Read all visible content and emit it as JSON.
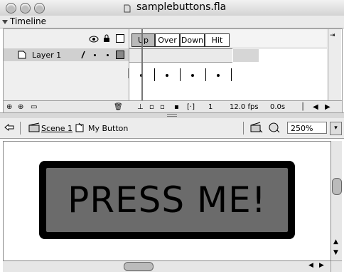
{
  "window": {
    "title": "samplebuttons.fla"
  },
  "timeline": {
    "panel_title": "Timeline",
    "layer_name": "Layer 1",
    "frame_labels": [
      "Up",
      "Over",
      "Down",
      "Hit"
    ],
    "status": {
      "current_frame": "1",
      "fps": "12.0 fps",
      "time": "0.0s"
    }
  },
  "navigation": {
    "scene": "Scene 1",
    "symbol": "My Button",
    "zoom": "250%"
  },
  "stage": {
    "button_text": "PRESS ME!"
  },
  "colors": {
    "button_fill": "#6b6b6b",
    "button_border": "#000000",
    "keyframe_header": "#a8a8a8"
  }
}
